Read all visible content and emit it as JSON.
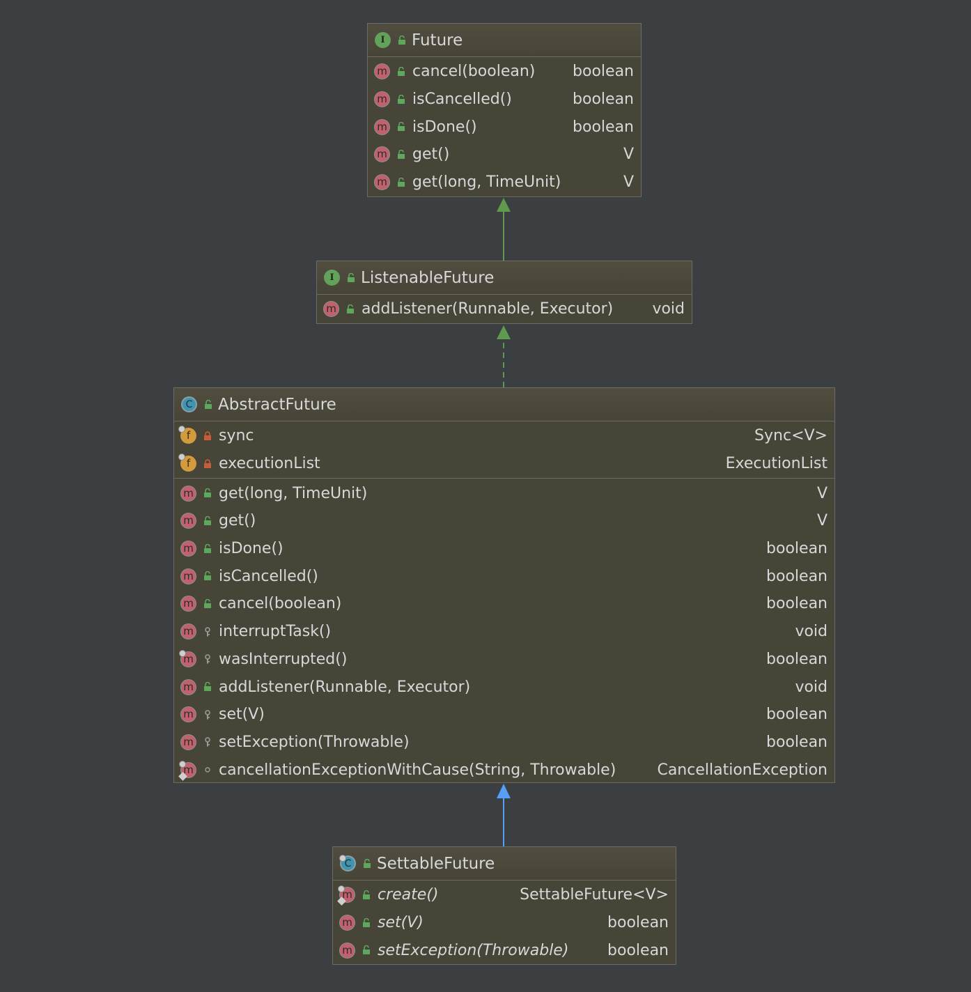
{
  "colors": {
    "background": "#3c3f41",
    "box_fill": "#474438",
    "box_border": "#6c6b64",
    "extends_arrow": "#5f9a4f",
    "implements_arrow": "#5f9a4f",
    "class_extends_arrow": "#589df6",
    "method_icon": "#c1616b",
    "interface_icon": "#62a25a",
    "class_icon": "#3f95b0",
    "field_icon": "#d49b3e",
    "public_vis": "#5ea85e",
    "private_vis": "#c75d3a",
    "protected_vis": "#9a9a9a"
  },
  "future": {
    "title": "Future",
    "kind_letter": "I",
    "methods": [
      {
        "name": "cancel(boolean)",
        "type": "boolean"
      },
      {
        "name": "isCancelled()",
        "type": "boolean"
      },
      {
        "name": "isDone()",
        "type": "boolean"
      },
      {
        "name": "get()",
        "type": "V"
      },
      {
        "name": "get(long, TimeUnit)",
        "type": "V"
      }
    ]
  },
  "listenable": {
    "title": "ListenableFuture",
    "kind_letter": "I",
    "methods": [
      {
        "name": "addListener(Runnable, Executor)",
        "type": "void"
      }
    ]
  },
  "abstract": {
    "title": "AbstractFuture",
    "kind_letter": "C",
    "fields": [
      {
        "name": "sync",
        "type": "Sync<V>"
      },
      {
        "name": "executionList",
        "type": "ExecutionList"
      }
    ],
    "methods": [
      {
        "name": "get(long, TimeUnit)",
        "type": "V"
      },
      {
        "name": "get()",
        "type": "V"
      },
      {
        "name": "isDone()",
        "type": "boolean"
      },
      {
        "name": "isCancelled()",
        "type": "boolean"
      },
      {
        "name": "cancel(boolean)",
        "type": "boolean"
      },
      {
        "name": "interruptTask()",
        "type": "void"
      },
      {
        "name": "wasInterrupted()",
        "type": "boolean"
      },
      {
        "name": "addListener(Runnable, Executor)",
        "type": "void"
      },
      {
        "name": "set(V)",
        "type": "boolean"
      },
      {
        "name": "setException(Throwable)",
        "type": "boolean"
      },
      {
        "name": "cancellationExceptionWithCause(String, Throwable)",
        "type": "CancellationException"
      }
    ]
  },
  "settable": {
    "title": "SettableFuture",
    "kind_letter": "C",
    "methods": [
      {
        "name": "create()",
        "type": "SettableFuture<V>"
      },
      {
        "name": "set(V)",
        "type": "boolean"
      },
      {
        "name": "setException(Throwable)",
        "type": "boolean"
      }
    ]
  },
  "icons": {
    "method": "m",
    "field": "f",
    "public_visibility": "open-lock-icon",
    "private_visibility": "lock-icon",
    "protected_visibility": "key-icon",
    "package_visibility": "dot-icon"
  }
}
